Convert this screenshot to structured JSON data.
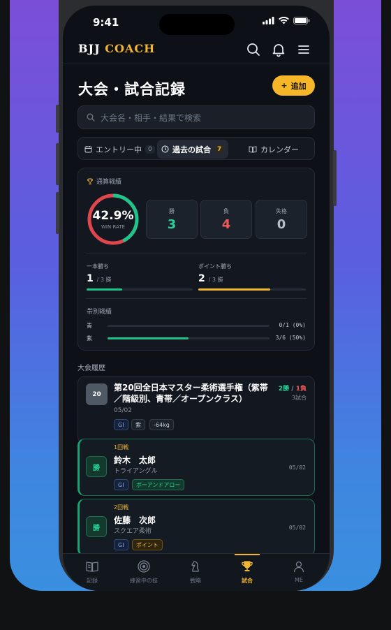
{
  "status": {
    "time": "9:41"
  },
  "app": {
    "logo_a": "BJJ",
    "logo_b": "COACH"
  },
  "page": {
    "title": "大会・試合記録",
    "add_label": "追加"
  },
  "search": {
    "placeholder": "大会名・相手・結果で検索"
  },
  "tabs": [
    {
      "label": "エントリー中",
      "count": "0"
    },
    {
      "label": "過去の試合",
      "count": "7",
      "active": true
    },
    {
      "label": "カレンダー"
    }
  ],
  "stats": {
    "header": "通算戦績",
    "win_rate_text": "42.9%",
    "win_rate_label": "WIN RATE",
    "win_rate": 0.429,
    "boxes": [
      {
        "label": "勝",
        "value": "3",
        "color": "#27d197"
      },
      {
        "label": "負",
        "value": "4",
        "color": "#f05a5a"
      },
      {
        "label": "失格",
        "value": "0",
        "color": "#b8bec8"
      }
    ],
    "wins_by": [
      {
        "label": "一本勝ち",
        "value": "1",
        "of": "/ 3 勝",
        "fraction": 0.333,
        "color": "#1fc48a"
      },
      {
        "label": "ポイント勝ち",
        "value": "2",
        "of": "/ 3 勝",
        "fraction": 0.667,
        "color": "#f2b632"
      }
    ],
    "belt_header": "帯別戦績",
    "belts": [
      {
        "name": "青",
        "record": "0/1 (0%)",
        "fraction": 0.0
      },
      {
        "name": "紫",
        "record": "3/6 (50%)",
        "fraction": 0.5
      }
    ]
  },
  "history": {
    "label": "大会履歴",
    "tournament": {
      "number": "20",
      "name": "第20回全日本マスター柔術選手権（紫帯／階級別、青帯／オープンクラス）",
      "result_win": "2勝",
      "result_sep": " / ",
      "result_loss": "1負",
      "matches_count": "3試合",
      "date": "05/02",
      "chips": [
        "GI",
        "紫",
        "-64kg"
      ]
    },
    "matches": [
      {
        "result": "勝",
        "round": "1回戦",
        "opponent": "鈴木　太郎",
        "technique": "トライアングル",
        "date": "05/02",
        "chips": [
          "GI",
          "ボーアンドアロー"
        ]
      },
      {
        "result": "勝",
        "round": "2回戦",
        "opponent": "佐藤　次郎",
        "technique": "スクエア柔術",
        "date": "05/02",
        "chips": [
          "GI",
          "ポイント"
        ]
      }
    ]
  },
  "tabbar": [
    {
      "label": "記録",
      "icon": "book-icon"
    },
    {
      "label": "練習中の技",
      "icon": "target-icon"
    },
    {
      "label": "戦略",
      "icon": "chess-knight-icon"
    },
    {
      "label": "試合",
      "icon": "trophy-icon",
      "active": true
    },
    {
      "label": "ME",
      "icon": "person-icon"
    }
  ]
}
